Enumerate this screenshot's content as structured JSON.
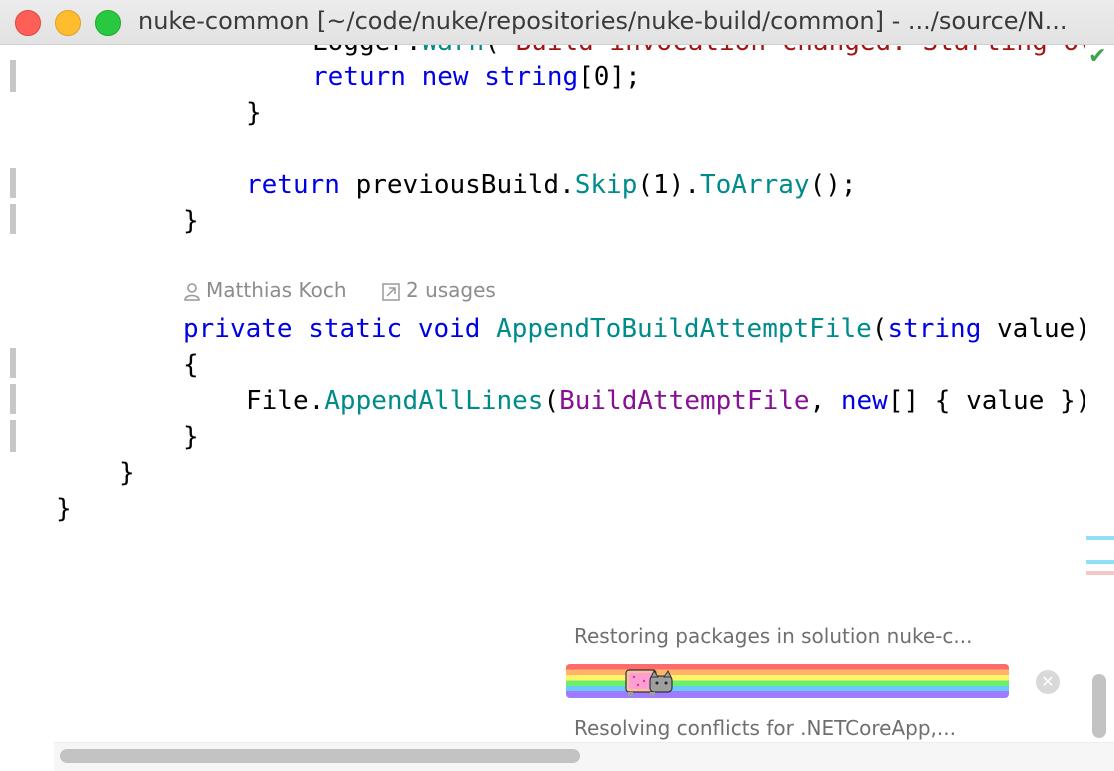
{
  "window": {
    "title": "nuke-common [~/code/nuke/repositories/nuke-build/common] - .../source/N..."
  },
  "editor": {
    "line_partial": {
      "obj": "Logger",
      "dot": ".",
      "method": "Warn",
      "paren": "(",
      "str": "\"Build invocation changed. Starting ov"
    },
    "line1": {
      "kw1": "return",
      "kw2": "new",
      "kw3": "string",
      "rest": "[0];"
    },
    "line2": {
      "text": "}"
    },
    "line3": {
      "kw": "return",
      "obj": "previousBuild.",
      "m1": "Skip",
      "arg": "(1).",
      "m2": "ToArray",
      "end": "();"
    },
    "line4": {
      "text": "}"
    },
    "hint": {
      "author": "Matthias Koch",
      "usages": "2 usages"
    },
    "line5": {
      "kw1": "private",
      "kw2": "static",
      "kw3": "void",
      "name": "AppendToBuildAttemptFile",
      "open": "(",
      "kw4": "string",
      "param": "value)"
    },
    "line6": {
      "text": "{"
    },
    "line7": {
      "obj": "File.",
      "method": "AppendAllLines",
      "open": "(",
      "field": "BuildAttemptFile",
      "sep": ", ",
      "kw": "new",
      "rest": "[] { value })"
    },
    "line8": {
      "text": "}"
    },
    "line9": {
      "text": "}"
    },
    "line10": {
      "text": "}"
    }
  },
  "progress": {
    "title": "Restoring packages in solution nuke-c...",
    "status": "Resolving conflicts for .NETCoreApp,...",
    "value_percent": 100,
    "cancel_icon": "close-circle-icon"
  },
  "colors": {
    "keyword": "#0000e6",
    "method": "#008b8b",
    "field": "#871094",
    "string": "#a31515"
  }
}
